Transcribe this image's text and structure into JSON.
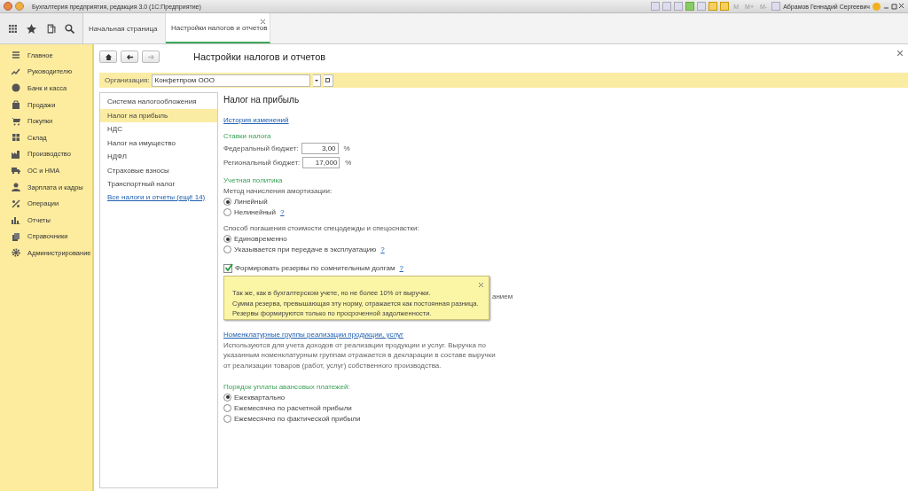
{
  "window": {
    "title": "Бухгалтерия предприятия, редакция 3.0  (1С:Предприятие)",
    "memory_buttons": [
      "M",
      "M+",
      "M-"
    ],
    "user": "Абрамов Геннадий Сергеевич"
  },
  "tabs": [
    {
      "label": "Начальная страница",
      "selected": false,
      "closable": false
    },
    {
      "label": "Настройки налогов и отчетов",
      "selected": true,
      "closable": true
    }
  ],
  "sidebar": {
    "items": [
      {
        "label": "Главное"
      },
      {
        "label": "Руководителю"
      },
      {
        "label": "Банк и касса"
      },
      {
        "label": "Продажи"
      },
      {
        "label": "Покупки"
      },
      {
        "label": "Склад"
      },
      {
        "label": "Производство"
      },
      {
        "label": "ОС и НМА"
      },
      {
        "label": "Зарплата и кадры"
      },
      {
        "label": "Операции"
      },
      {
        "label": "Отчеты"
      },
      {
        "label": "Справочники"
      },
      {
        "label": "Администрирование"
      }
    ]
  },
  "form": {
    "title": "Настройки налогов и отчетов",
    "organization": {
      "label": "Организация:",
      "value": "Конфетпром ООО"
    },
    "nav": [
      {
        "label": "Система налогообложения",
        "selected": false
      },
      {
        "label": "Налог на прибыль",
        "selected": true
      },
      {
        "label": "НДС",
        "selected": false
      },
      {
        "label": "Налог на имущество",
        "selected": false
      },
      {
        "label": "НДФЛ",
        "selected": false
      },
      {
        "label": "Страховые взносы",
        "selected": false
      },
      {
        "label": "Транспортный налог",
        "selected": false
      }
    ],
    "nav_link": "Все налоги и отчеты (ещё 14)",
    "section": {
      "title": "Налог на прибыль",
      "history_link": "История изменений",
      "rates_heading": "Ставки налога",
      "rates": [
        {
          "label": "Федеральный бюджет:",
          "value": "3,00",
          "unit": "%"
        },
        {
          "label": "Региональный бюджет:",
          "value": "17,000",
          "unit": "%"
        }
      ],
      "policy_heading": "Учетная политика",
      "groups": [
        {
          "label": "Метод начисления амортизации:",
          "options": [
            {
              "label": "Линейный",
              "selected": true
            },
            {
              "label": "Нелинейный",
              "selected": false,
              "help": "?"
            }
          ]
        },
        {
          "label": "Способ погашения стоимости спецодежды и спецоснастки:",
          "options": [
            {
              "label": "Единовременно",
              "selected": true
            },
            {
              "label": "Указывается при передаче в эксплуатацию",
              "selected": false,
              "help": "?"
            }
          ]
        }
      ],
      "reserve": {
        "label": "Формировать резервы по сомнительным долгам",
        "checked": true,
        "help": "?"
      },
      "fragment": "анием",
      "groups_link": "Номенклатурные группы реализации продукции, услуг",
      "groups_note": "Используются для учета доходов от реализации продукции и услуг. Выручка по указанным номенклатурным группам отражается в декларации в составе выручки от реализации товаров (работ, услуг) собственного производства.",
      "advance_heading": "Порядок уплаты авансовых платежей:",
      "advance_options": [
        {
          "label": "Ежеквартально",
          "selected": true
        },
        {
          "label": "Ежемесячно по расчетной прибыли",
          "selected": false
        },
        {
          "label": "Ежемесячно по фактической прибыли",
          "selected": false
        }
      ]
    }
  },
  "tooltip": {
    "lines": [
      "Так же, как в бухгалтерском учете, но не более 10% от выручки.",
      "Сумма резерва, превышающая эту норму, отражается как постоянная разница.",
      "Резервы формируются только по просроченной задолженности."
    ]
  }
}
